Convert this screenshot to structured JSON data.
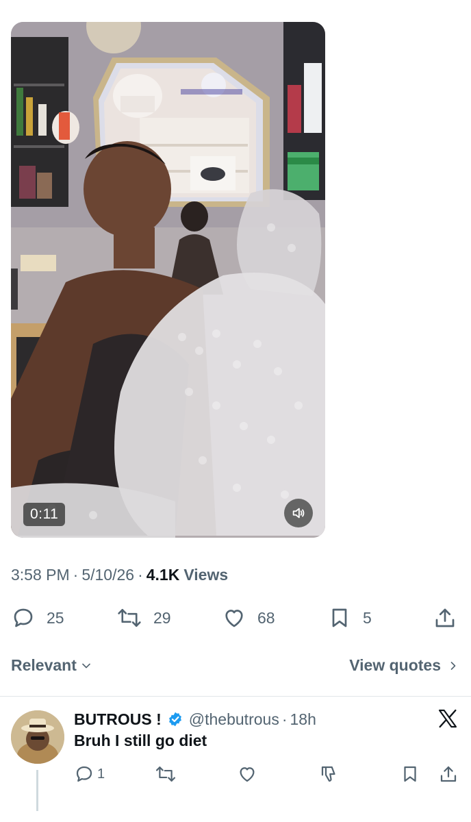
{
  "video": {
    "duration": "0:11",
    "mute_icon": "speaker-muted-icon"
  },
  "tweet_meta": {
    "time": "3:58 PM",
    "date": "5/10/26",
    "views_count": "4.1K",
    "views_label": "Views"
  },
  "actions": {
    "replies": "25",
    "reposts": "29",
    "likes": "68",
    "bookmarks": "5"
  },
  "sort": {
    "relevant_label": "Relevant",
    "view_quotes_label": "View quotes"
  },
  "reply": {
    "name": "BUTROUS !",
    "handle": "@thebutrous",
    "time": "18h",
    "text": "Bruh I still go diet",
    "reply_count": "1"
  },
  "colors": {
    "secondary_text": "#536471",
    "primary_text": "#0f1419",
    "verified_blue": "#1d9bf0"
  }
}
